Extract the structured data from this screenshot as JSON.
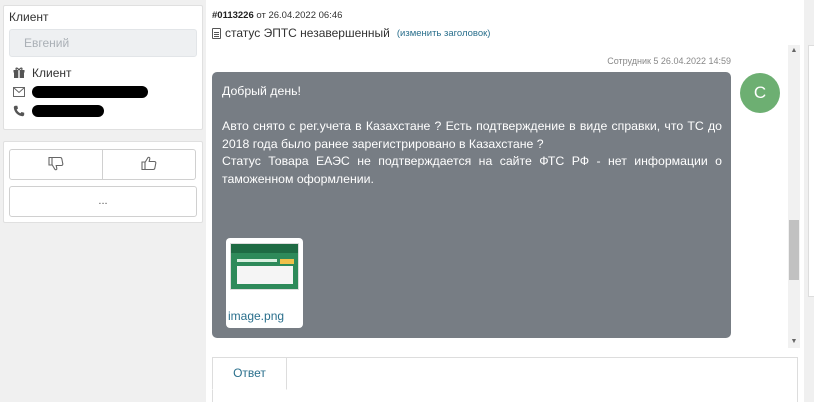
{
  "left": {
    "title": "Клиент",
    "name_value": "Евгений",
    "client_label": "Клиент",
    "icons": {
      "client": "gift-icon",
      "email": "mail-icon",
      "phone": "phone-icon"
    },
    "more_label": "..."
  },
  "ticket": {
    "number": "#0113226",
    "date_text": "от 26.04.2022 06:46",
    "subject": "статус ЭПТС незавершенный",
    "edit_link": "(изменить заголовок)"
  },
  "message": {
    "sender": "Сотрудник 5 26.04.2022 14:59",
    "avatar_letter": "С",
    "lines": [
      "Добрый день!",
      "",
      "Авто снято с рег.учета в Казахстане ? Есть подтверждение в виде справки, что ТС до 2018 года было ранее зарегистрировано в Казахстане ?",
      "Статус Товара ЕАЭС не подтверждается на сайте ФТС РФ - нет информации о таможенном оформлении."
    ],
    "attachment": "image.png"
  },
  "reply": {
    "tab_label": "Ответ"
  },
  "colors": {
    "bubble": "#777d84",
    "avatar": "#6daf72",
    "link": "#2a6f8c"
  }
}
